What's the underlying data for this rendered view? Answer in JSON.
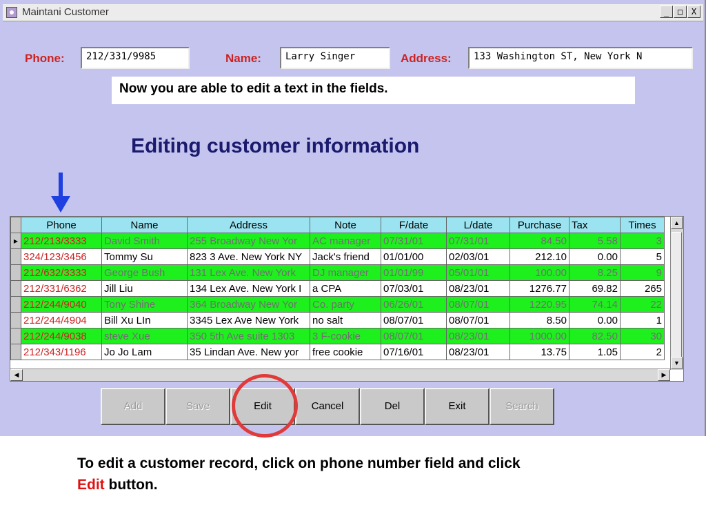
{
  "window": {
    "title": "Maintani Customer",
    "controls": [
      "_",
      "□",
      "X"
    ]
  },
  "form": {
    "phone_label": "Phone:",
    "phone_value": "212/331/9985",
    "name_label": "Name:",
    "name_value": "Larry Singer",
    "address_label": "Address:",
    "address_value": "133 Washington ST, New York N"
  },
  "callout": "Now you are able to edit a text in the fields.",
  "heading": "Editing customer information",
  "grid": {
    "columns": [
      "Phone",
      "Name",
      "Address",
      "Note",
      "F/date",
      "L/date",
      "Purchase",
      "Tax",
      "Times"
    ],
    "rows": [
      {
        "highlight": "green",
        "current": true,
        "cells": [
          "212/213/3333",
          "David Smith",
          "255 Broadway New Yor",
          "AC manager",
          "07/31/01",
          "07/31/01",
          "84.50",
          "5.58",
          "3"
        ]
      },
      {
        "highlight": "white",
        "current": false,
        "cells": [
          "324/123/3456",
          "Tommy Su",
          "823 3 Ave. New York NY",
          "Jack's friend",
          "01/01/00",
          "02/03/01",
          "212.10",
          "0.00",
          "5"
        ]
      },
      {
        "highlight": "green",
        "current": false,
        "cells": [
          "212/632/3333",
          "George Bush",
          "131 Lex Ave. New York",
          "DJ manager",
          "01/01/99",
          "05/01/01",
          "100.00",
          "8.25",
          "9"
        ]
      },
      {
        "highlight": "white",
        "current": false,
        "cells": [
          "212/331/6362",
          "Jill Liu",
          "134 Lex Ave. New York I",
          "a CPA",
          "07/03/01",
          "08/23/01",
          "1276.77",
          "69.82",
          "265"
        ]
      },
      {
        "highlight": "green",
        "current": false,
        "cells": [
          "212/244/9040",
          "Tony Shine",
          "364 Broadway New Yor",
          "Co. party",
          "06/26/01",
          "08/07/01",
          "1220.95",
          "74.14",
          "22"
        ]
      },
      {
        "highlight": "white",
        "current": false,
        "cells": [
          "212/244/4904",
          "Bill Xu LIn",
          "3345 Lex Ave New York",
          "no salt",
          "08/07/01",
          "08/07/01",
          "8.50",
          "0.00",
          "1"
        ]
      },
      {
        "highlight": "green",
        "current": false,
        "cells": [
          "212/244/9038",
          "steve Xue",
          "350 5th Ave suite 1303",
          "3 F-cookie",
          "08/07/01",
          "08/23/01",
          "1000.00",
          "82.50",
          "30"
        ]
      },
      {
        "highlight": "white",
        "current": false,
        "cells": [
          "212/343/1196",
          "Jo Jo Lam",
          "35 Lindan Ave. New yor",
          "free cookie",
          "07/16/01",
          "08/23/01",
          "13.75",
          "1.05",
          "2"
        ]
      }
    ]
  },
  "toolbar": [
    {
      "label": "Add",
      "enabled": false
    },
    {
      "label": "Save",
      "enabled": false
    },
    {
      "label": "Edit",
      "enabled": true
    },
    {
      "label": "Cancel",
      "enabled": true
    },
    {
      "label": "Del",
      "enabled": true
    },
    {
      "label": "Exit",
      "enabled": true
    },
    {
      "label": "Search",
      "enabled": false
    }
  ],
  "caption": {
    "line1": "To edit a customer record, click on phone number field and click",
    "highlight": "Edit",
    "line2_rest": " button."
  },
  "colors": {
    "window_bg": "#c4c4ee",
    "row_highlight": "#1ef01e",
    "header_bg": "#9be3f0",
    "label_red": "#cc2222",
    "annotation_red": "#e03a3a",
    "arrow_blue": "#1f3fe0"
  },
  "icons": {
    "app": "app-icon",
    "arrow": "down-arrow-icon",
    "circle": "highlight-circle"
  }
}
